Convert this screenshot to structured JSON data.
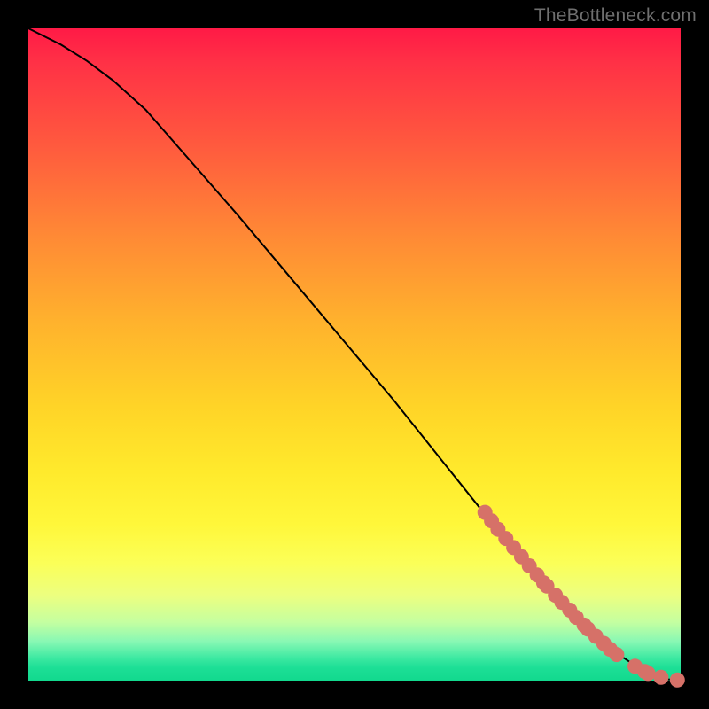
{
  "attribution": "TheBottleneck.com",
  "colors": {
    "dot": "#d67168",
    "line": "#000000"
  },
  "chart_data": {
    "type": "line",
    "title": "",
    "xlabel": "",
    "ylabel": "",
    "xlim": [
      0,
      1
    ],
    "ylim": [
      0,
      1
    ],
    "annotations": [],
    "legend": null,
    "curve_note": "Monotone decreasing curve; gentle shoulder at top-left, near-linear through the middle, flattening to ~0 at the right edge. Axis tick labels are not shown, so x/y are normalized [0,1].",
    "series": [
      {
        "name": "curve",
        "kind": "line",
        "x": [
          0.0,
          0.02,
          0.05,
          0.09,
          0.13,
          0.18,
          0.25,
          0.32,
          0.4,
          0.48,
          0.56,
          0.64,
          0.7,
          0.76,
          0.82,
          0.87,
          0.905,
          0.935,
          0.96,
          0.98,
          1.0
        ],
        "y": [
          1.0,
          0.99,
          0.975,
          0.95,
          0.92,
          0.875,
          0.795,
          0.715,
          0.62,
          0.525,
          0.43,
          0.33,
          0.255,
          0.185,
          0.12,
          0.07,
          0.04,
          0.02,
          0.008,
          0.002,
          0.0
        ]
      },
      {
        "name": "data-points",
        "kind": "scatter",
        "x": [
          0.7,
          0.71,
          0.72,
          0.732,
          0.744,
          0.756,
          0.768,
          0.78,
          0.79,
          0.795,
          0.808,
          0.818,
          0.83,
          0.84,
          0.852,
          0.858,
          0.87,
          0.882,
          0.892,
          0.902,
          0.93,
          0.945,
          0.95,
          0.97,
          0.995
        ],
        "y": [
          0.258,
          0.245,
          0.232,
          0.218,
          0.204,
          0.19,
          0.176,
          0.162,
          0.15,
          0.145,
          0.131,
          0.12,
          0.108,
          0.097,
          0.085,
          0.079,
          0.068,
          0.057,
          0.048,
          0.04,
          0.022,
          0.014,
          0.011,
          0.005,
          0.001
        ]
      }
    ]
  }
}
